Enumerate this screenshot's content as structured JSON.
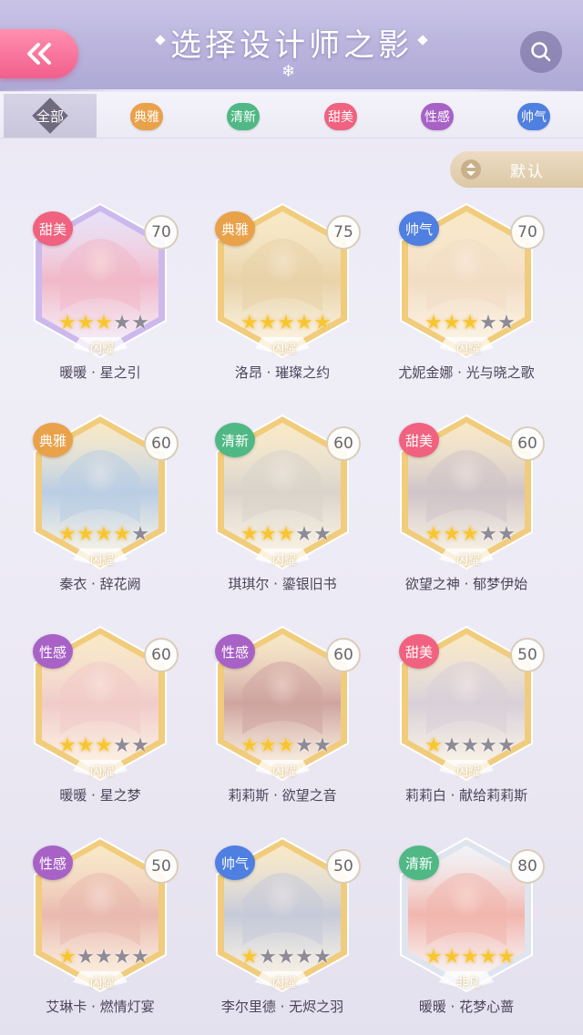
{
  "header": {
    "title": "选择设计师之影",
    "back_icon": "double-chevron-left-icon",
    "search_icon": "search-icon"
  },
  "filter_tabs": [
    {
      "label": "全部",
      "color": "#6f6a7d",
      "selected": true
    },
    {
      "label": "典雅",
      "color": "#e9a14a",
      "selected": false
    },
    {
      "label": "清新",
      "color": "#4fb884",
      "selected": false
    },
    {
      "label": "甜美",
      "color": "#f0627f",
      "selected": false
    },
    {
      "label": "性感",
      "color": "#a862c6",
      "selected": false
    },
    {
      "label": "帅气",
      "color": "#4f7fe0",
      "selected": false
    }
  ],
  "sort": {
    "label": "默认",
    "icon": "sort-arrows-icon"
  },
  "cards": [
    {
      "name": "暖暖 · 星之引",
      "style": "甜美",
      "style_color": "#f0627f",
      "level": "70",
      "stars": 3,
      "badge": "闪耀",
      "frame": "#cbb9ee",
      "portrait": "#f1b8c8"
    },
    {
      "name": "洛昂 · 璀璨之约",
      "style": "典雅",
      "style_color": "#e9a14a",
      "level": "75",
      "stars": 5,
      "badge": "闪耀",
      "frame": "#f0cc7c",
      "portrait": "#e8d2a8"
    },
    {
      "name": "尤妮金娜 · 光与晓之歌",
      "style": "帅气",
      "style_color": "#4f7fe0",
      "level": "70",
      "stars": 3,
      "badge": "闪耀",
      "frame": "#f0cc7c",
      "portrait": "#f2dcc4"
    },
    {
      "name": "秦衣 · 辞花阙",
      "style": "典雅",
      "style_color": "#e9a14a",
      "level": "60",
      "stars": 4,
      "badge": "闪耀",
      "frame": "#f0cc7c",
      "portrait": "#b9cde4"
    },
    {
      "name": "琪琪尔 · 鎏银旧书",
      "style": "清新",
      "style_color": "#4fb884",
      "level": "60",
      "stars": 3,
      "badge": "闪耀",
      "frame": "#f0cc7c",
      "portrait": "#d9d3cb"
    },
    {
      "name": "欲望之神 · 郁梦伊始",
      "style": "甜美",
      "style_color": "#f0627f",
      "level": "60",
      "stars": 3,
      "badge": "闪耀",
      "frame": "#f0cc7c",
      "portrait": "#cfc4c8"
    },
    {
      "name": "暖暖 · 星之梦",
      "style": "性感",
      "style_color": "#a862c6",
      "level": "60",
      "stars": 3,
      "badge": "闪耀",
      "frame": "#f0cc7c",
      "portrait": "#f0cbc9"
    },
    {
      "name": "莉莉斯 · 欲望之音",
      "style": "性感",
      "style_color": "#a862c6",
      "level": "60",
      "stars": 3,
      "badge": "闪耀",
      "frame": "#f0cc7c",
      "portrait": "#cfa4a0"
    },
    {
      "name": "莉莉白 · 献给莉莉斯",
      "style": "甜美",
      "style_color": "#f0627f",
      "level": "50",
      "stars": 1,
      "badge": "闪耀",
      "frame": "#f0cc7c",
      "portrait": "#d8cfd8"
    },
    {
      "name": "艾琳卡 · 燃情灯宴",
      "style": "性感",
      "style_color": "#a862c6",
      "level": "50",
      "stars": 1,
      "badge": "闪耀",
      "frame": "#f0cc7c",
      "portrait": "#e9b9ae"
    },
    {
      "name": "李尔里德 · 无烬之羽",
      "style": "帅气",
      "style_color": "#4f7fe0",
      "level": "50",
      "stars": 1,
      "badge": "闪耀",
      "frame": "#f0cc7c",
      "portrait": "#c7cad8"
    },
    {
      "name": "暖暖 · 花梦心蔷",
      "style": "清新",
      "style_color": "#4fb884",
      "level": "80",
      "stars": 5,
      "badge": "非凡",
      "frame": "#dfe4ee",
      "portrait": "#f1b6ad"
    }
  ]
}
